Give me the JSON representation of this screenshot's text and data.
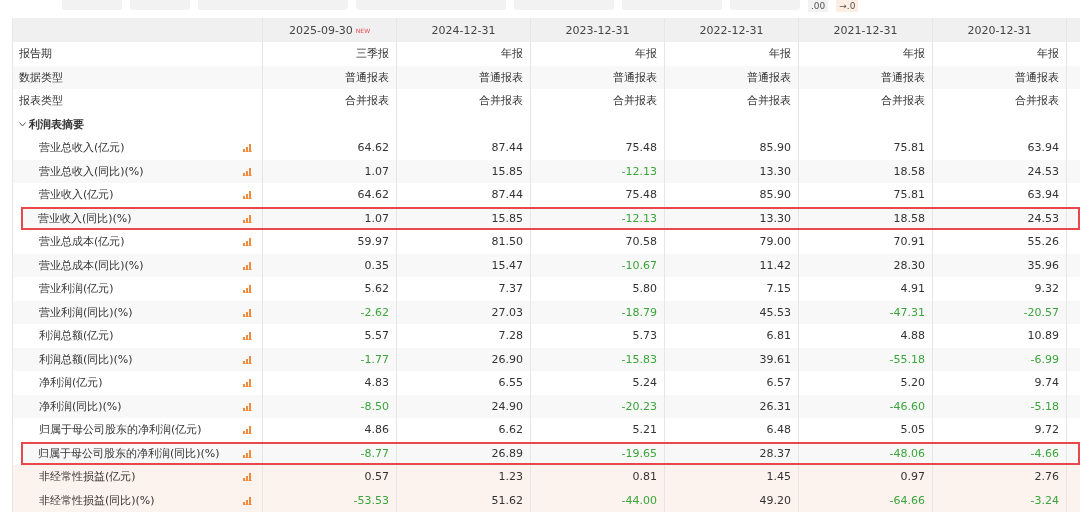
{
  "toolbar": {
    "decimal_buttons": [
      ".00",
      "→.0"
    ]
  },
  "table": {
    "columns": [
      {
        "label": "2025-09-30",
        "badge": "NEW"
      },
      {
        "label": "2024-12-31"
      },
      {
        "label": "2023-12-31"
      },
      {
        "label": "2022-12-31"
      },
      {
        "label": "2021-12-31"
      },
      {
        "label": "2020-12-31"
      }
    ],
    "info_rows": [
      {
        "label": "报告期",
        "values": [
          "三季报",
          "年报",
          "年报",
          "年报",
          "年报",
          "年报"
        ]
      },
      {
        "label": "数据类型",
        "values": [
          "普通报表",
          "普通报表",
          "普通报表",
          "普通报表",
          "普通报表",
          "普通报表"
        ]
      },
      {
        "label": "报表类型",
        "values": [
          "合并报表",
          "合并报表",
          "合并报表",
          "合并报表",
          "合并报表",
          "合并报表"
        ]
      }
    ],
    "sections": [
      {
        "label": "利润表摘要",
        "expanded": true,
        "children": [
          {
            "label": "营业总收入(亿元)",
            "highlighted": false,
            "shaded": false,
            "values": [
              "64.62",
              "87.44",
              "75.48",
              "85.90",
              "75.81",
              "63.94"
            ],
            "negatives": [
              false,
              false,
              false,
              false,
              false,
              false
            ]
          },
          {
            "label": "营业总收入(同比)(%)",
            "highlighted": false,
            "shaded": false,
            "values": [
              "1.07",
              "15.85",
              "-12.13",
              "13.30",
              "18.58",
              "24.53"
            ],
            "negatives": [
              false,
              false,
              true,
              false,
              false,
              false
            ]
          },
          {
            "label": "营业收入(亿元)",
            "highlighted": false,
            "shaded": false,
            "values": [
              "64.62",
              "87.44",
              "75.48",
              "85.90",
              "75.81",
              "63.94"
            ],
            "negatives": [
              false,
              false,
              false,
              false,
              false,
              false
            ]
          },
          {
            "label": "营业收入(同比)(%)",
            "highlighted": true,
            "shaded": false,
            "values": [
              "1.07",
              "15.85",
              "-12.13",
              "13.30",
              "18.58",
              "24.53"
            ],
            "negatives": [
              false,
              false,
              true,
              false,
              false,
              false
            ]
          },
          {
            "label": "营业总成本(亿元)",
            "highlighted": false,
            "shaded": false,
            "values": [
              "59.97",
              "81.50",
              "70.58",
              "79.00",
              "70.91",
              "55.26"
            ],
            "negatives": [
              false,
              false,
              false,
              false,
              false,
              false
            ]
          },
          {
            "label": "营业总成本(同比)(%)",
            "highlighted": false,
            "shaded": false,
            "values": [
              "0.35",
              "15.47",
              "-10.67",
              "11.42",
              "28.30",
              "35.96"
            ],
            "negatives": [
              false,
              false,
              true,
              false,
              false,
              false
            ]
          },
          {
            "label": "营业利润(亿元)",
            "highlighted": false,
            "shaded": false,
            "values": [
              "5.62",
              "7.37",
              "5.80",
              "7.15",
              "4.91",
              "9.32"
            ],
            "negatives": [
              false,
              false,
              false,
              false,
              false,
              false
            ]
          },
          {
            "label": "营业利润(同比)(%)",
            "highlighted": false,
            "shaded": false,
            "values": [
              "-2.62",
              "27.03",
              "-18.79",
              "45.53",
              "-47.31",
              "-20.57"
            ],
            "negatives": [
              true,
              false,
              true,
              false,
              true,
              true
            ]
          },
          {
            "label": "利润总额(亿元)",
            "highlighted": false,
            "shaded": false,
            "values": [
              "5.57",
              "7.28",
              "5.73",
              "6.81",
              "4.88",
              "10.89"
            ],
            "negatives": [
              false,
              false,
              false,
              false,
              false,
              false
            ]
          },
          {
            "label": "利润总额(同比)(%)",
            "highlighted": false,
            "shaded": false,
            "values": [
              "-1.77",
              "26.90",
              "-15.83",
              "39.61",
              "-55.18",
              "-6.99"
            ],
            "negatives": [
              true,
              false,
              true,
              false,
              true,
              true
            ]
          },
          {
            "label": "净利润(亿元)",
            "highlighted": false,
            "shaded": false,
            "values": [
              "4.83",
              "6.55",
              "5.24",
              "6.57",
              "5.20",
              "9.74"
            ],
            "negatives": [
              false,
              false,
              false,
              false,
              false,
              false
            ]
          },
          {
            "label": "净利润(同比)(%)",
            "highlighted": false,
            "shaded": false,
            "values": [
              "-8.50",
              "24.90",
              "-20.23",
              "26.31",
              "-46.60",
              "-5.18"
            ],
            "negatives": [
              true,
              false,
              true,
              false,
              true,
              true
            ]
          },
          {
            "label": "归属于母公司股东的净利润(亿元)",
            "highlighted": false,
            "shaded": false,
            "values": [
              "4.86",
              "6.62",
              "5.21",
              "6.48",
              "5.05",
              "9.72"
            ],
            "negatives": [
              false,
              false,
              false,
              false,
              false,
              false
            ]
          },
          {
            "label": "归属于母公司股东的净利润(同比)(%)",
            "highlighted": true,
            "shaded": false,
            "values": [
              "-8.77",
              "26.89",
              "-19.65",
              "28.37",
              "-48.06",
              "-4.66"
            ],
            "negatives": [
              true,
              false,
              true,
              false,
              true,
              true
            ]
          },
          {
            "label": "非经常性损益(亿元)",
            "highlighted": false,
            "shaded": true,
            "values": [
              "0.57",
              "1.23",
              "0.81",
              "1.45",
              "0.97",
              "2.76"
            ],
            "negatives": [
              false,
              false,
              false,
              false,
              false,
              false
            ]
          },
          {
            "label": "非经常性损益(同比)(%)",
            "highlighted": false,
            "shaded": true,
            "values": [
              "-53.53",
              "51.62",
              "-44.00",
              "49.20",
              "-64.66",
              "-3.24"
            ],
            "negatives": [
              true,
              false,
              true,
              false,
              true,
              true
            ]
          }
        ]
      }
    ]
  }
}
